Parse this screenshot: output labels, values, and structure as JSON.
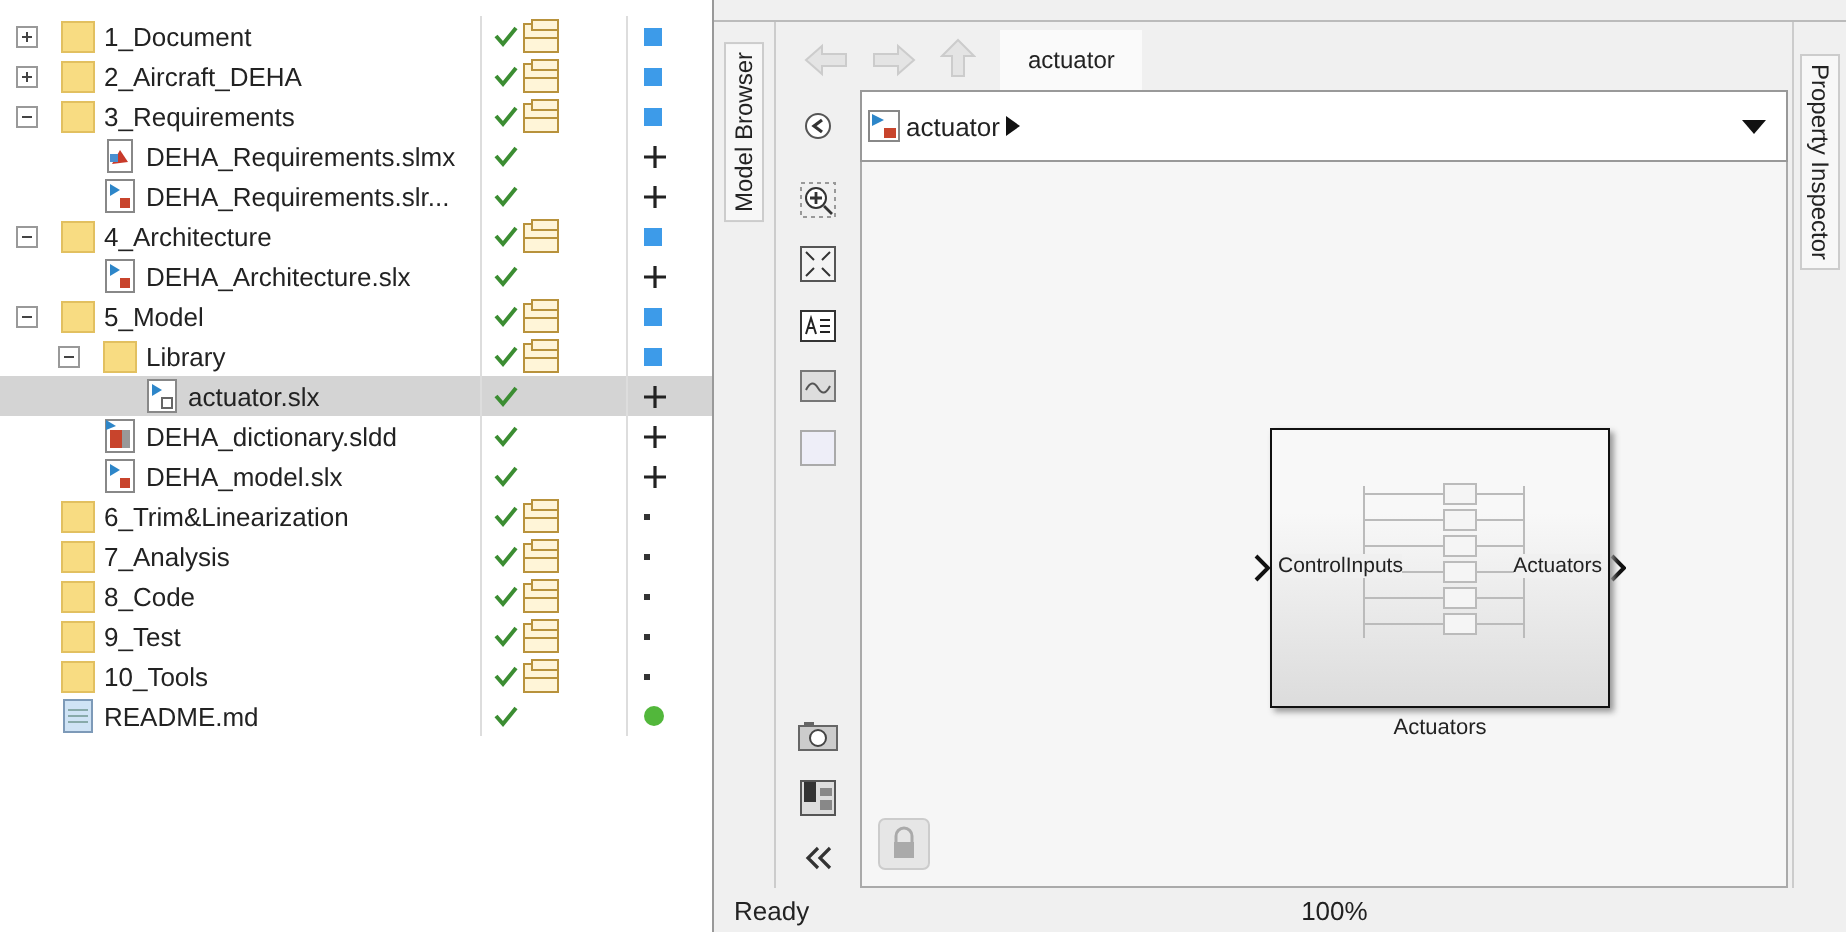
{
  "tree": [
    {
      "name": "1_Document",
      "kind": "folder",
      "expanded": false,
      "status": {
        "kind": "folder"
      },
      "marker": {
        "kind": "square"
      },
      "selected": false
    },
    {
      "name": "2_Aircraft_DEHA",
      "kind": "folder",
      "expanded": false,
      "status": {
        "kind": "folder"
      },
      "marker": {
        "kind": "square"
      },
      "selected": false
    },
    {
      "name": "3_Requirements",
      "kind": "folder",
      "expanded": true,
      "status": {
        "kind": "folder"
      },
      "marker": {
        "kind": "square"
      },
      "selected": false,
      "children": [
        {
          "name": "DEHA_Requirements.slmx",
          "kind": "slmx",
          "status": {
            "kind": "file"
          },
          "marker": {
            "kind": "plus"
          },
          "selected": false
        },
        {
          "name": "DEHA_Requirements.slr...",
          "kind": "slx",
          "status": {
            "kind": "file"
          },
          "marker": {
            "kind": "plus"
          },
          "selected": false
        }
      ]
    },
    {
      "name": "4_Architecture",
      "kind": "folder",
      "expanded": true,
      "status": {
        "kind": "folder"
      },
      "marker": {
        "kind": "square"
      },
      "selected": false,
      "children": [
        {
          "name": "DEHA_Architecture.slx",
          "kind": "slx",
          "status": {
            "kind": "file"
          },
          "marker": {
            "kind": "plus"
          },
          "selected": false
        }
      ]
    },
    {
      "name": "5_Model",
      "kind": "folder",
      "expanded": true,
      "status": {
        "kind": "folder"
      },
      "marker": {
        "kind": "square"
      },
      "selected": false,
      "children": [
        {
          "name": "Library",
          "kind": "folder",
          "expanded": true,
          "status": {
            "kind": "folder"
          },
          "marker": {
            "kind": "square"
          },
          "selected": false,
          "children": [
            {
              "name": "actuator.slx",
              "kind": "lib",
              "status": {
                "kind": "file"
              },
              "marker": {
                "kind": "plus"
              },
              "selected": true
            }
          ]
        },
        {
          "name": "DEHA_dictionary.sldd",
          "kind": "sldd",
          "status": {
            "kind": "file"
          },
          "marker": {
            "kind": "plus"
          },
          "selected": false
        },
        {
          "name": "DEHA_model.slx",
          "kind": "slx",
          "status": {
            "kind": "file"
          },
          "marker": {
            "kind": "plus"
          },
          "selected": false
        }
      ]
    },
    {
      "name": "6_Trim&Linearization",
      "kind": "folder",
      "status": {
        "kind": "folder"
      },
      "marker": {
        "kind": "dot"
      },
      "selected": false
    },
    {
      "name": "7_Analysis",
      "kind": "folder",
      "status": {
        "kind": "folder"
      },
      "marker": {
        "kind": "dot"
      },
      "selected": false
    },
    {
      "name": "8_Code",
      "kind": "folder",
      "status": {
        "kind": "folder"
      },
      "marker": {
        "kind": "dot"
      },
      "selected": false
    },
    {
      "name": "9_Test",
      "kind": "folder",
      "status": {
        "kind": "folder"
      },
      "marker": {
        "kind": "dot"
      },
      "selected": false
    },
    {
      "name": "10_Tools",
      "kind": "folder",
      "status": {
        "kind": "folder"
      },
      "marker": {
        "kind": "dot"
      },
      "selected": false
    },
    {
      "name": "README.md",
      "kind": "md",
      "status": {
        "kind": "file"
      },
      "marker": {
        "kind": "circle"
      },
      "selected": false
    }
  ],
  "model_browser": {
    "label": "Model Browser"
  },
  "tabs": [
    {
      "label": "actuator",
      "selected": true
    }
  ],
  "breadcrumb": "actuator",
  "block": {
    "input": "ControlInputs",
    "output": "Actuators",
    "name": "Actuators"
  },
  "property_inspector": {
    "label": "Property Inspector"
  },
  "status_bar": {
    "message": "Ready",
    "zoom": "100%"
  }
}
